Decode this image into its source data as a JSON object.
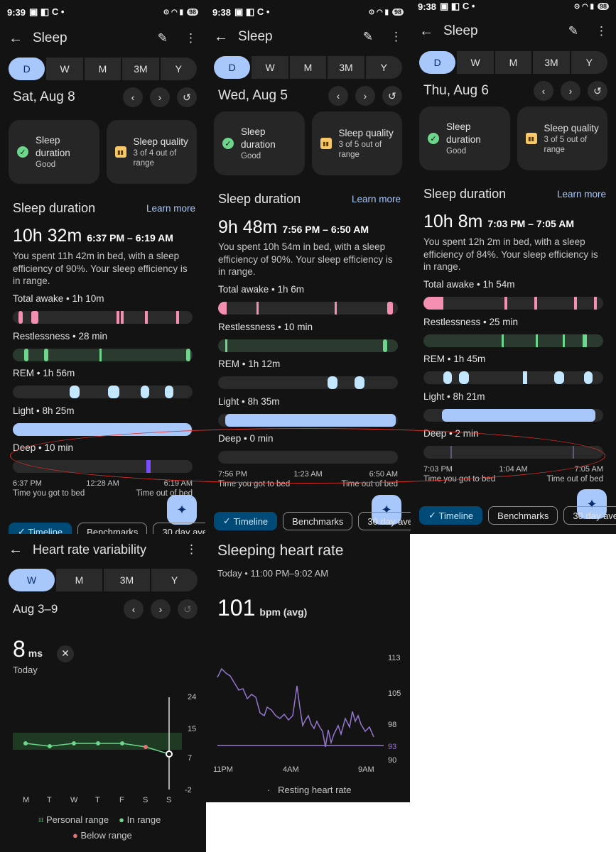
{
  "colors": {
    "bg": "#131313",
    "accent": "#a8c7fa",
    "awake": "#f48fb1",
    "restless": "#6dd58c",
    "rem": "#c2e7ff",
    "light": "#a8c7fa",
    "deep": "#7c4dff",
    "highlight": "#e0302b",
    "hr_line": "#9575cd"
  },
  "panels": [
    {
      "status": {
        "time": "9:39",
        "battery": "98"
      },
      "header": {
        "title": "Sleep"
      },
      "tabs": [
        "D",
        "W",
        "M",
        "3M",
        "Y"
      ],
      "date": "Sat, Aug 8",
      "cards": [
        {
          "title": "Sleep duration",
          "sub": "Good"
        },
        {
          "title": "Sleep quality",
          "sub": "3 of 4 out of range"
        }
      ],
      "section": {
        "title": "Sleep duration",
        "link": "Learn more"
      },
      "duration": "10h 32m",
      "range": "6:37 PM – 6:19 AM",
      "summary": "You spent 11h 42m in bed, with a sleep efficiency of 90%. Your sleep efficiency is in range.",
      "stages": [
        "Total awake • 1h 10m",
        "Restlessness • 28 min",
        "REM • 1h 56m",
        "Light • 8h 25m",
        "Deep • 10 min"
      ],
      "timeline": [
        "6:37 PM",
        "12:28 AM",
        "6:19 AM"
      ],
      "bed": "Time you got to bed",
      "out": "Time out of bed",
      "chips": [
        "Timeline",
        "Benchmarks",
        "30 day ave"
      ]
    },
    {
      "status": {
        "time": "9:38",
        "battery": "98"
      },
      "header": {
        "title": "Sleep"
      },
      "tabs": [
        "D",
        "W",
        "M",
        "3M",
        "Y"
      ],
      "date": "Wed, Aug 5",
      "cards": [
        {
          "title": "Sleep duration",
          "sub": "Good"
        },
        {
          "title": "Sleep quality",
          "sub": "3 of 5 out of range"
        }
      ],
      "section": {
        "title": "Sleep duration",
        "link": "Learn more"
      },
      "duration": "9h 48m",
      "range": "7:56 PM – 6:50 AM",
      "summary": "You spent 10h 54m in bed, with a sleep efficiency of 90%. Your sleep efficiency is in range.",
      "stages": [
        "Total awake • 1h 6m",
        "Restlessness • 10 min",
        "REM • 1h 12m",
        "Light • 8h 35m",
        "Deep • 0 min"
      ],
      "timeline": [
        "7:56 PM",
        "1:23 AM",
        "6:50 AM"
      ],
      "bed": "Time you got to bed",
      "out": "Time out of bed",
      "chips": [
        "Timeline",
        "Benchmarks",
        "30 day ave"
      ]
    },
    {
      "status": {
        "time": "9:38",
        "battery": "98"
      },
      "header": {
        "title": "Sleep"
      },
      "tabs": [
        "D",
        "W",
        "M",
        "3M",
        "Y"
      ],
      "date": "Thu, Aug 6",
      "cards": [
        {
          "title": "Sleep duration",
          "sub": "Good"
        },
        {
          "title": "Sleep quality",
          "sub": "3 of 5 out of range"
        }
      ],
      "section": {
        "title": "Sleep duration",
        "link": "Learn more"
      },
      "duration": "10h 8m",
      "range": "7:03 PM – 7:05 AM",
      "summary": "You spent 12h 2m in bed, with a sleep efficiency of 84%. Your sleep efficiency is in range.",
      "stages": [
        "Total awake • 1h 54m",
        "Restlessness • 25 min",
        "REM • 1h 45m",
        "Light • 8h 21m",
        "Deep • 2 min"
      ],
      "timeline": [
        "7:03 PM",
        "1:04 AM",
        "7:05 AM"
      ],
      "bed": "Time you got to bed",
      "out": "Time out of bed",
      "chips": [
        "Timeline",
        "Benchmarks",
        "30 day ave"
      ]
    }
  ],
  "hrv": {
    "title": "Heart rate variability",
    "tabs": [
      "W",
      "M",
      "3M",
      "Y"
    ],
    "range": "Aug 3–9",
    "value": "8",
    "unit": "ms",
    "when": "Today",
    "yticks": [
      "24",
      "15",
      "7",
      "-2"
    ],
    "days": [
      "M",
      "T",
      "W",
      "T",
      "F",
      "S",
      "S"
    ],
    "legend": [
      "Personal range",
      "In range",
      "Below range"
    ]
  },
  "shr": {
    "title": "Sleeping heart rate",
    "sub": "Today • 11:00 PM–9:02 AM",
    "value": "101",
    "unit": "bpm (avg)",
    "yticks": [
      "113",
      "105",
      "98",
      "93",
      "90"
    ],
    "xticks": [
      "11PM",
      "4AM",
      "9AM"
    ],
    "legend": "Resting heart rate"
  },
  "chart_data": [
    {
      "type": "line",
      "title": "Heart rate variability",
      "x": [
        "M",
        "T",
        "W",
        "T",
        "F",
        "S",
        "S"
      ],
      "series": [
        {
          "values": [
            10.5,
            9.5,
            10.5,
            10.5,
            10.5,
            9,
            7.5
          ]
        }
      ],
      "ylim": [
        -2,
        24
      ]
    },
    {
      "type": "line",
      "title": "Sleeping heart rate",
      "x": [
        "11PM",
        "4AM",
        "9AM"
      ],
      "ylim": [
        90,
        113
      ],
      "series": [
        {
          "name": "Resting heart rate",
          "values": [
            93,
            93,
            93
          ]
        }
      ]
    }
  ]
}
